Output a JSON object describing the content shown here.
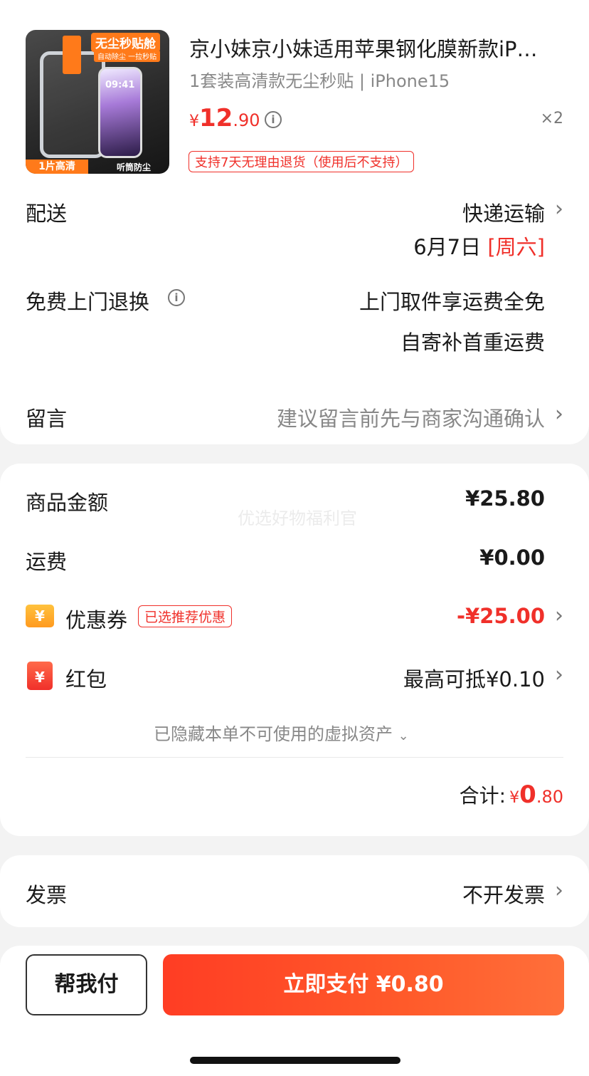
{
  "product": {
    "image_badge_top": "无尘秒贴舱",
    "image_badge_sub": "自动除尘 一拉秒贴",
    "image_badge_left": "1片高清",
    "image_badge_right": "听筒防尘",
    "image_phone_time": "09:41",
    "title": "京小妹京小妹适用苹果钢化膜新款iP…",
    "spec": "1套装高清款无尘秒贴 | iPhone15",
    "price_symbol": "¥",
    "price_int": "12",
    "price_dec": ".90",
    "info_icon": "info-icon",
    "qty": "×2",
    "return_tag": "支持7天无理由退货（使用后不支持）"
  },
  "delivery": {
    "label": "配送",
    "method": "快递运输",
    "date": "6月7日",
    "weekday": "[周六]"
  },
  "free_return": {
    "label": "免费上门退换",
    "line1": "上门取件享运费全免",
    "line2": "自寄补首重运费"
  },
  "message": {
    "label": "留言",
    "placeholder": "建议留言前先与商家沟通确认"
  },
  "watermark": "优选好物福利官",
  "summary": {
    "goods_label": "商品金额",
    "goods_value": "¥25.80",
    "shipping_label": "运费",
    "shipping_value": "¥0.00",
    "coupon_icon_text": "¥",
    "coupon_label": "优惠券",
    "coupon_tag": "已选推荐优惠",
    "coupon_value": "-¥25.00",
    "redpack_icon_text": "¥",
    "redpack_label": "红包",
    "redpack_value": "最高可抵¥0.10",
    "hidden_assets": "已隐藏本单不可使用的虚拟资产",
    "total_label": "合计:",
    "total_symbol": "¥",
    "total_int": "0",
    "total_dec": ".80"
  },
  "invoice": {
    "label": "发票",
    "value": "不开发票"
  },
  "actions": {
    "help_pay": "帮我付",
    "pay_now": "立即支付 ¥0.80"
  },
  "colors": {
    "accent_red": "#f0302a",
    "pay_button": "#ff4a26"
  }
}
